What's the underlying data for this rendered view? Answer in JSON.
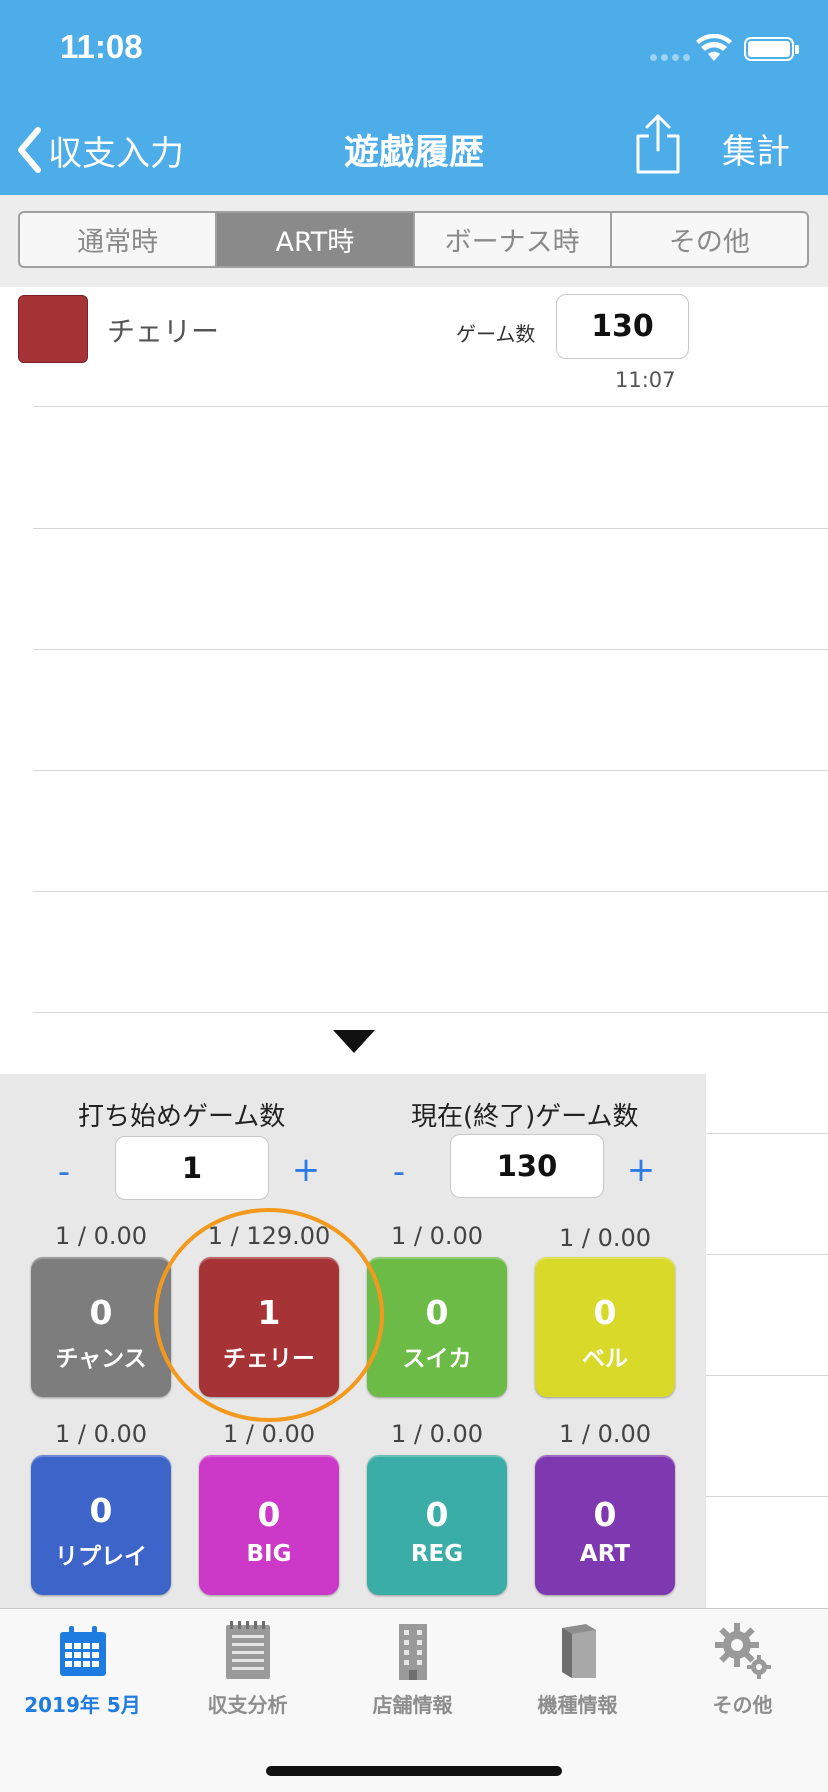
{
  "status_bar": {
    "time": "11:08"
  },
  "nav": {
    "back_label": "収支入力",
    "title": "遊戯履歴",
    "tally_label": "集計"
  },
  "segments": [
    {
      "label": "通常時",
      "active": false
    },
    {
      "label": "ART時",
      "active": true
    },
    {
      "label": "ボーナス時",
      "active": false
    },
    {
      "label": "その他",
      "active": false
    }
  ],
  "history": [
    {
      "label": "チェリー",
      "game_label": "ゲーム数",
      "game_value": "130",
      "time": "11:07",
      "color": "#A63336"
    }
  ],
  "panel": {
    "start_label": "打ち始めゲーム数",
    "start_value": "1",
    "current_label": "現在(終了)ゲーム数",
    "current_value": "130",
    "minus": "-",
    "plus": "+",
    "counters": [
      {
        "ratio": "1 / 0.00",
        "count": "0",
        "label": "チャンス",
        "color": "#7D7D7D"
      },
      {
        "ratio": "1 / 129.00",
        "count": "1",
        "label": "チェリー",
        "color": "#A63336"
      },
      {
        "ratio": "1 / 0.00",
        "count": "0",
        "label": "スイカ",
        "color": "#6DBB47"
      },
      {
        "ratio": "1 / 0.00",
        "count": "0",
        "label": "ベル",
        "color": "#D9D92A"
      },
      {
        "ratio": "1 / 0.00",
        "count": "0",
        "label": "リプレイ",
        "color": "#3D64C8"
      },
      {
        "ratio": "1 / 0.00",
        "count": "0",
        "label": "BIG",
        "color": "#CC39C8"
      },
      {
        "ratio": "1 / 0.00",
        "count": "0",
        "label": "REG",
        "color": "#3AAEA6"
      },
      {
        "ratio": "1 / 0.00",
        "count": "0",
        "label": "ART",
        "color": "#7E38B0"
      }
    ]
  },
  "tabs": [
    {
      "label": "2019年 5月",
      "icon": "calendar-icon",
      "active": true
    },
    {
      "label": "収支分析",
      "icon": "notepad-icon",
      "active": false
    },
    {
      "label": "店舗情報",
      "icon": "building-icon",
      "active": false
    },
    {
      "label": "機種情報",
      "icon": "book-icon",
      "active": false
    },
    {
      "label": "その他",
      "icon": "gear-icon",
      "active": false
    }
  ],
  "colors": {
    "nav_bar": "#4DADE8",
    "tab_active": "#1E7BE0",
    "stepper": "#2E7BE6",
    "highlight": "#F39A1E"
  }
}
